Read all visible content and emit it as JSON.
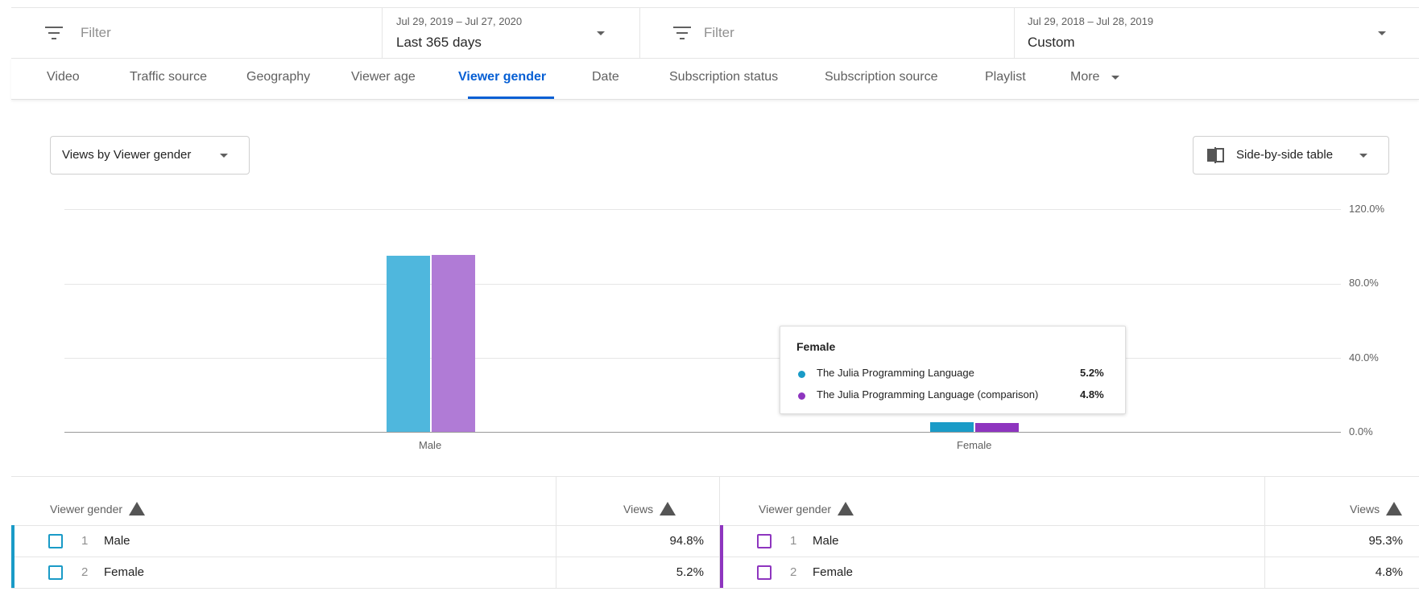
{
  "filters": {
    "left": {
      "filter_placeholder": "Filter",
      "range_dates": "Jul 29, 2019 – Jul 27, 2020",
      "range_name": "Last 365 days"
    },
    "right": {
      "filter_placeholder": "Filter",
      "range_dates": "Jul 29, 2018 – Jul 28, 2019",
      "range_name": "Custom"
    }
  },
  "tabs": [
    "Video",
    "Traffic source",
    "Geography",
    "Viewer age",
    "Viewer gender",
    "Date",
    "Subscription status",
    "Subscription source",
    "Playlist",
    "More"
  ],
  "active_tab": "Viewer gender",
  "metric_dropdown": {
    "label": "Views by Viewer gender"
  },
  "view_dropdown": {
    "label": "Side-by-side table"
  },
  "icons": [
    "filter-icon",
    "chevron-down-icon",
    "side-by-side-icon",
    "warning-icon"
  ],
  "colors": {
    "primary": "#4fb7dd",
    "comparison": "#b07bd6",
    "primary_dark": "#1a9bc7",
    "comparison_dark": "#8e35bf",
    "active_tab": "#065fd4"
  },
  "chart_data": {
    "type": "bar",
    "categories": [
      "Male",
      "Female"
    ],
    "series": [
      {
        "name": "The Julia Programming Language",
        "values": [
          94.8,
          5.2
        ]
      },
      {
        "name": "The Julia Programming Language (comparison)",
        "values": [
          95.3,
          4.8
        ]
      }
    ],
    "ylim": [
      0,
      120
    ],
    "yticks": [
      "120.0%",
      "80.0%",
      "40.0%",
      "0.0%"
    ],
    "grid": true
  },
  "tooltip": {
    "title": "Female",
    "rows": [
      {
        "name": "The Julia Programming Language",
        "value": "5.2%"
      },
      {
        "name": "The Julia Programming Language (comparison)",
        "value": "4.8%"
      }
    ]
  },
  "tables": [
    {
      "header_dim": "Viewer gender",
      "header_metric": "Views",
      "rows": [
        {
          "num": "1",
          "name": "Male",
          "value": "94.8%"
        },
        {
          "num": "2",
          "name": "Female",
          "value": "5.2%"
        }
      ]
    },
    {
      "header_dim": "Viewer gender",
      "header_metric": "Views",
      "rows": [
        {
          "num": "1",
          "name": "Male",
          "value": "95.3%"
        },
        {
          "num": "2",
          "name": "Female",
          "value": "4.8%"
        }
      ]
    }
  ]
}
